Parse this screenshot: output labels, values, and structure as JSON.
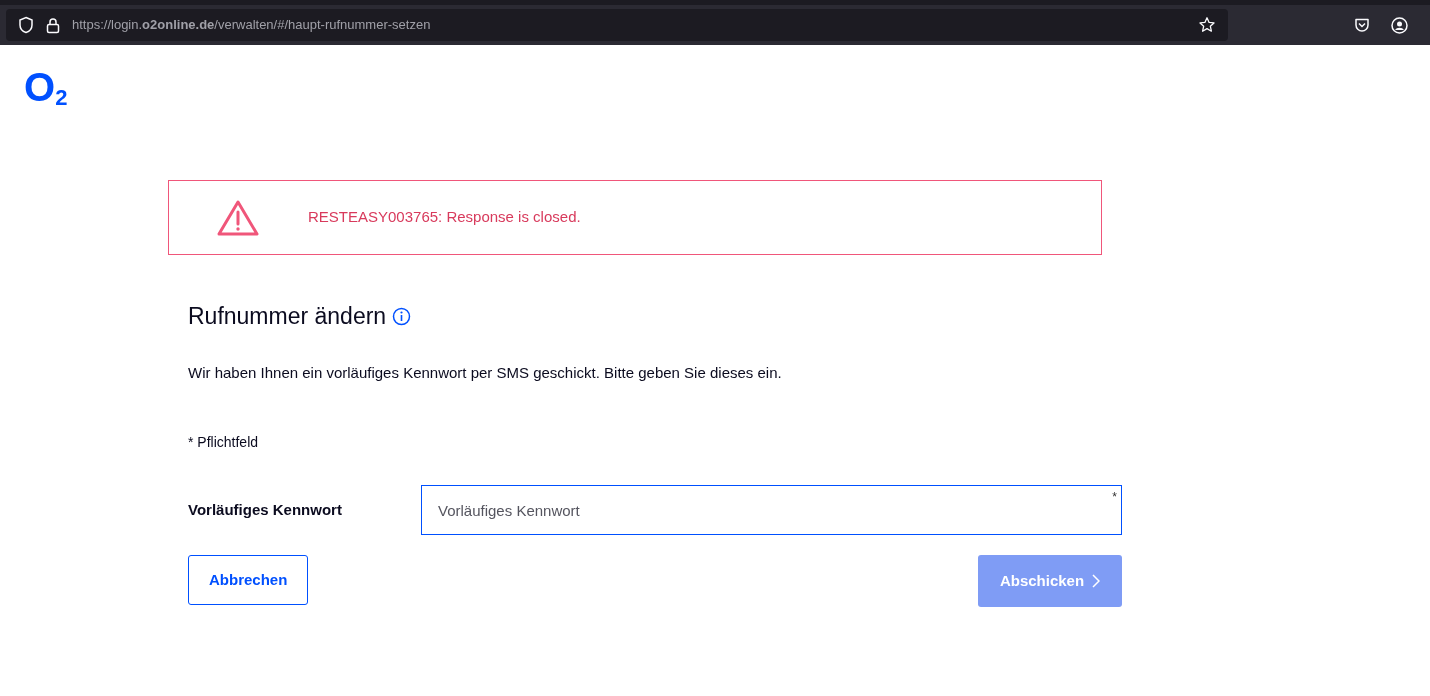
{
  "browser": {
    "url": "https://login.**o2online.de**/verwalten/#/haupt-rufnummer-setzen"
  },
  "logo": "O$_{2}$",
  "error": {
    "message": "RESTEASY003765: Response is closed."
  },
  "heading": "Rufnummer ändern",
  "intro": "Wir haben Ihnen ein vorläufiges Kennwort per SMS geschickt. Bitte geben Sie dieses ein.",
  "required_note": "* Pflichtfeld",
  "field": {
    "label": "Vorläufiges Kennwort",
    "placeholder": "Vorläufiges Kennwort",
    "required_mark": "*"
  },
  "buttons": [
    {
      "kind": "secondary",
      "label": "Abbrechen",
      "disabled": false
    },
    {
      "kind": "primary",
      "label": "Abschicken",
      "disabled": true
    }
  ]
}
